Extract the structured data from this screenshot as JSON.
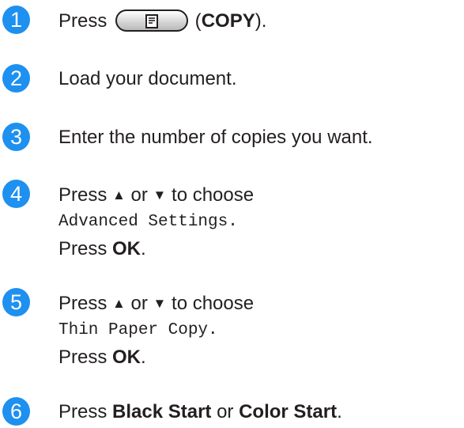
{
  "steps": [
    {
      "number": "1",
      "lines": [
        {
          "pre": "Press ",
          "icon": "copy-key-icon",
          "mid": " (",
          "bold": "COPY",
          "post": ")."
        }
      ]
    },
    {
      "number": "2",
      "lines": [
        {
          "text": "Load your document."
        }
      ]
    },
    {
      "number": "3",
      "lines": [
        {
          "text": "Enter the number of copies you want."
        }
      ]
    },
    {
      "number": "4",
      "lines": [
        {
          "pre": "Press ",
          "up": "▲",
          "or": " or ",
          "down": "▼",
          "post": " to choose"
        },
        {
          "mono": "Advanced Settings."
        },
        {
          "pre": "Press ",
          "bold": "OK",
          "post": "."
        }
      ]
    },
    {
      "number": "5",
      "lines": [
        {
          "pre": "Press ",
          "up": "▲",
          "or": " or ",
          "down": "▼",
          "post": " to choose"
        },
        {
          "mono": "Thin Paper Copy."
        },
        {
          "pre": "Press ",
          "bold": "OK",
          "post": "."
        }
      ]
    },
    {
      "number": "6",
      "lines": [
        {
          "pre": "Press ",
          "bold": "Black Start",
          "or": " or ",
          "bold2": "Color Start",
          "post": "."
        }
      ]
    }
  ],
  "colors": {
    "badge": "#1e90f0",
    "text": "#231f20"
  }
}
